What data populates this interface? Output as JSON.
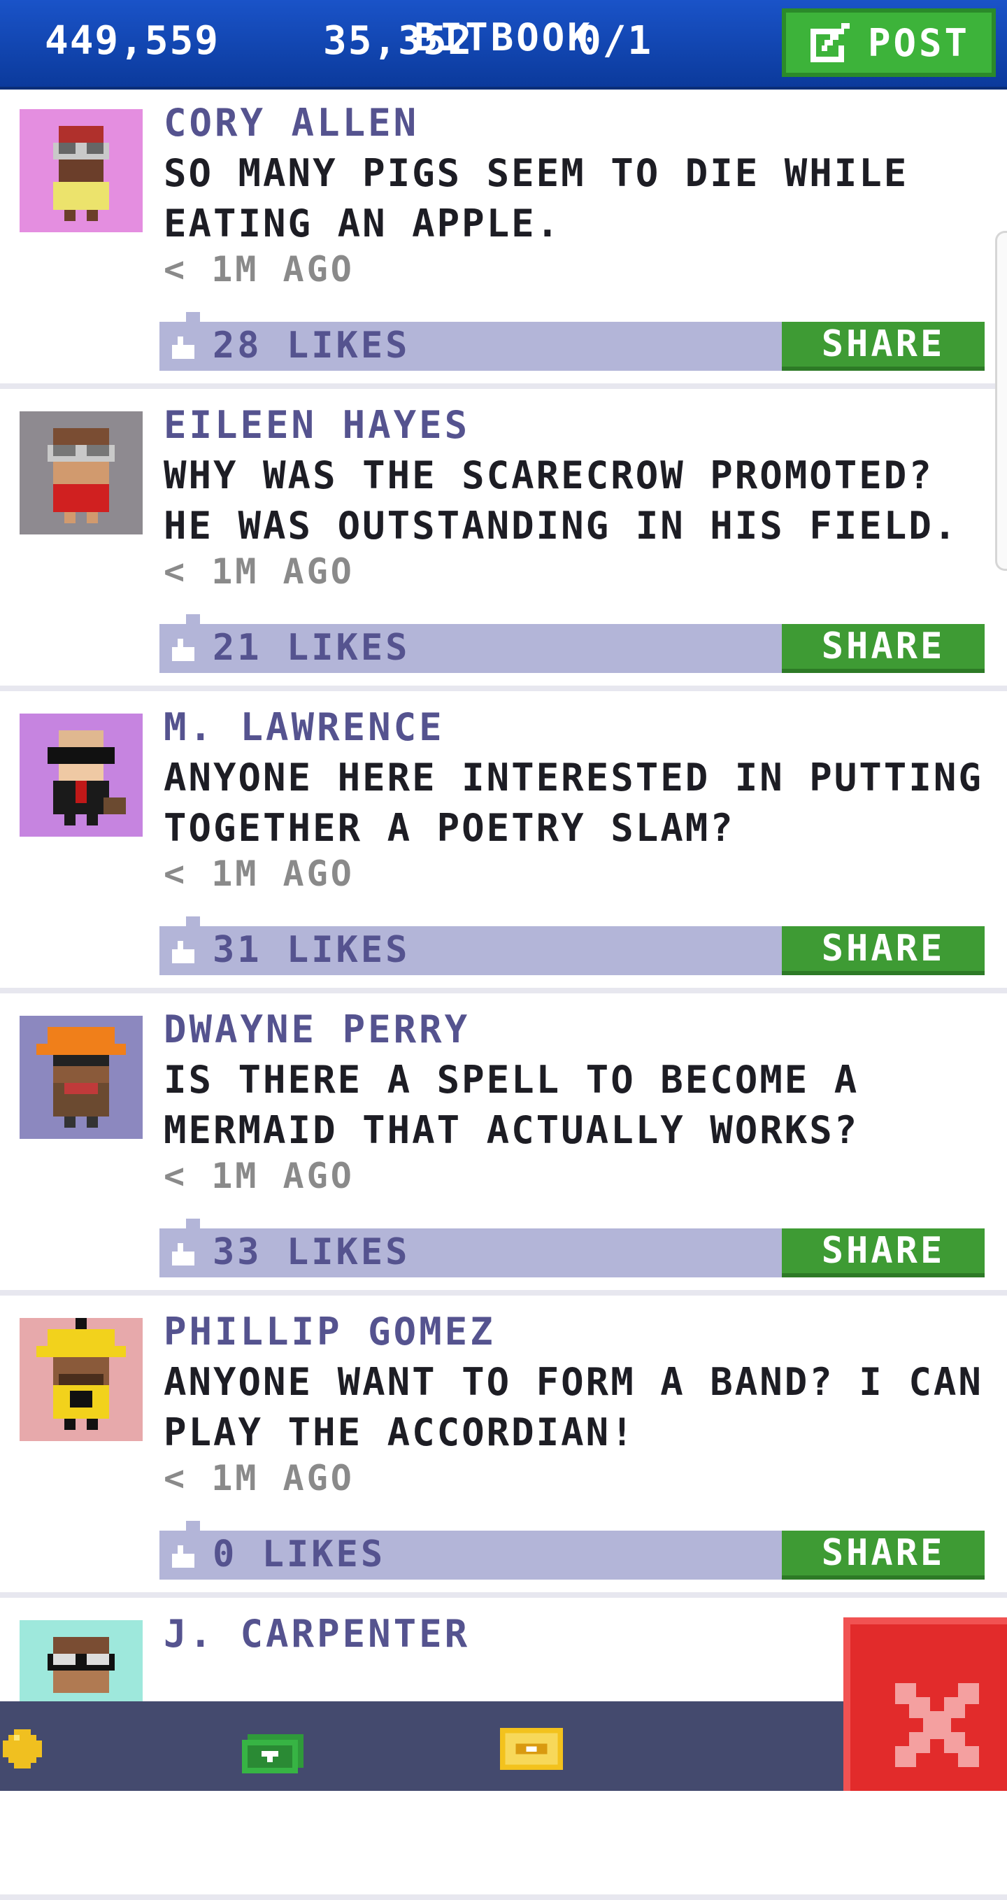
{
  "header": {
    "title": "BITBOOK",
    "post_label": "POST"
  },
  "posts": [
    {
      "author": "CORY ALLEN",
      "message": "SO MANY PIGS SEEM TO DIE WHILE EATING AN APPLE.",
      "time": "< 1M AGO",
      "likes": "28 LIKES",
      "share": "SHARE",
      "avatar_bg": "#e48ee0",
      "avatar_icon": "avatar-red-cap-glasses"
    },
    {
      "author": "EILEEN HAYES",
      "message": "WHY WAS THE SCARECROW PROMOTED? HE WAS OUTSTANDING IN HIS FIELD.",
      "time": "< 1M AGO",
      "likes": "21 LIKES",
      "share": "SHARE",
      "avatar_bg": "#8e8a90",
      "avatar_icon": "avatar-glasses-red-shirt"
    },
    {
      "author": "M. LAWRENCE",
      "message": "ANYONE HERE INTERESTED IN PUTTING TOGETHER A POETRY SLAM?",
      "time": "< 1M AGO",
      "likes": "31 LIKES",
      "share": "SHARE",
      "avatar_bg": "#c684e0",
      "avatar_icon": "avatar-sunglasses-suit"
    },
    {
      "author": "DWAYNE PERRY",
      "message": "IS THERE A SPELL TO BECOME A MERMAID THAT ACTUALLY WORKS?",
      "time": "< 1M AGO",
      "likes": "33 LIKES",
      "share": "SHARE",
      "avatar_bg": "#8c88bf",
      "avatar_icon": "avatar-hard-hat"
    },
    {
      "author": "PHILLIP GOMEZ",
      "message": "ANYONE WANT TO FORM A BAND? I CAN PLAY THE ACCORDIAN!",
      "time": "< 1M AGO",
      "likes": "0 LIKES",
      "share": "SHARE",
      "avatar_bg": "#e7a9ab",
      "avatar_icon": "avatar-yellow-hat"
    },
    {
      "author": "J. CARPENTER",
      "message": "",
      "time": "",
      "likes": "",
      "share": "",
      "avatar_bg": "#9ee8dc",
      "avatar_icon": "avatar-glasses"
    }
  ],
  "resources": {
    "coins": "449,559",
    "bux": "35,352",
    "tickets": "0/1"
  },
  "colors": {
    "topbar": "#1a53c8",
    "accent_green": "#3db33a",
    "likes_bar": "#b3b5d8",
    "author_text": "#55538f",
    "bottom_bar": "#444a6e",
    "close_red": "#e22b2b"
  }
}
